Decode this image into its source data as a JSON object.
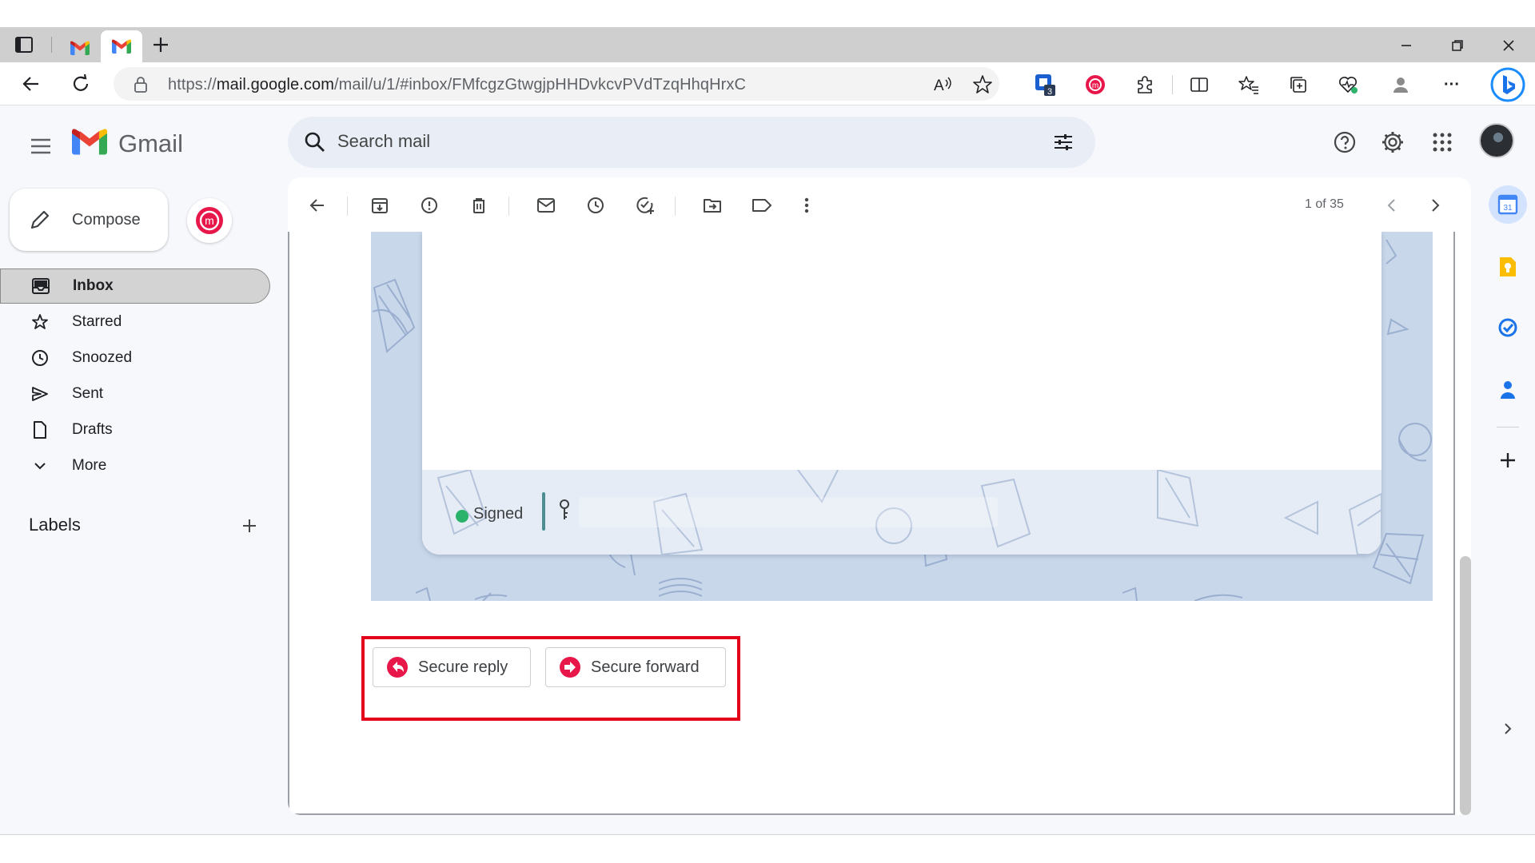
{
  "browser": {
    "url_prefix": "https://",
    "url_host": "mail.google.com",
    "url_path": "/mail/u/1/#inbox/FMfcgzGtwgjpHHDvkcvPVdTzqHhqHrxC",
    "extension_badge": "3",
    "more_label": "···"
  },
  "gmail": {
    "product_name": "Gmail",
    "search": {
      "placeholder": "Search mail"
    },
    "compose_label": "Compose",
    "nav": [
      {
        "label": "Inbox",
        "icon": "inbox-icon"
      },
      {
        "label": "Starred",
        "icon": "star-icon"
      },
      {
        "label": "Snoozed",
        "icon": "clock-icon"
      },
      {
        "label": "Sent",
        "icon": "send-icon"
      },
      {
        "label": "Drafts",
        "icon": "draft-icon"
      },
      {
        "label": "More",
        "icon": "chevron-down-icon"
      }
    ],
    "labels_title": "Labels"
  },
  "message": {
    "pager": "1 of 35",
    "signature_status": "Signed",
    "actions": {
      "secure_reply": "Secure reply",
      "secure_forward": "Secure forward"
    }
  },
  "colors": {
    "highlight": "#e3001b",
    "mailvelope_red": "#e8174a",
    "signed_green": "#2bb36b",
    "pattern_blue": "#c9d7ea"
  }
}
